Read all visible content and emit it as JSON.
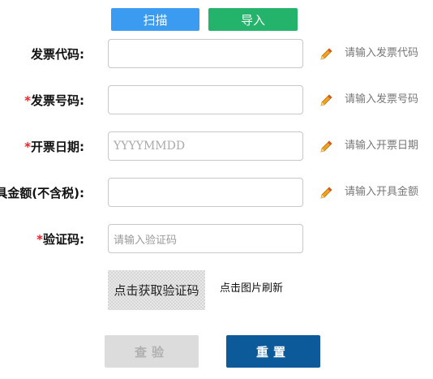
{
  "toolbar": {
    "scan_label": "扫描",
    "import_label": "导入",
    "scan_color": "#3a9bf0",
    "import_color": "#23b36a"
  },
  "form": {
    "fields": [
      {
        "label": "发票代码:",
        "required": false,
        "placeholder": "",
        "hint": "请输入发票代码"
      },
      {
        "label": "发票号码:",
        "required": true,
        "placeholder": "",
        "hint": "请输入发票号码"
      },
      {
        "label": "开票日期:",
        "required": true,
        "placeholder": "YYYYMMDD",
        "hint": "请输入开票日期"
      },
      {
        "label": "具金额(不含税):",
        "required": false,
        "placeholder": "",
        "hint": "请输入开具金额"
      },
      {
        "label": "验证码:",
        "required": true,
        "placeholder": "请输入验证码",
        "hint": ""
      }
    ],
    "required_mark": "*",
    "required_color": "#e8232a"
  },
  "captcha": {
    "image_text": "点击获取验证码",
    "refresh_text": "点击图片刷新"
  },
  "actions": {
    "query_label": "查验",
    "reset_label": "重置",
    "query_color": "#dcdcdc",
    "reset_color": "#0d5a9b"
  },
  "icons": {
    "edit": "pencil-icon"
  }
}
